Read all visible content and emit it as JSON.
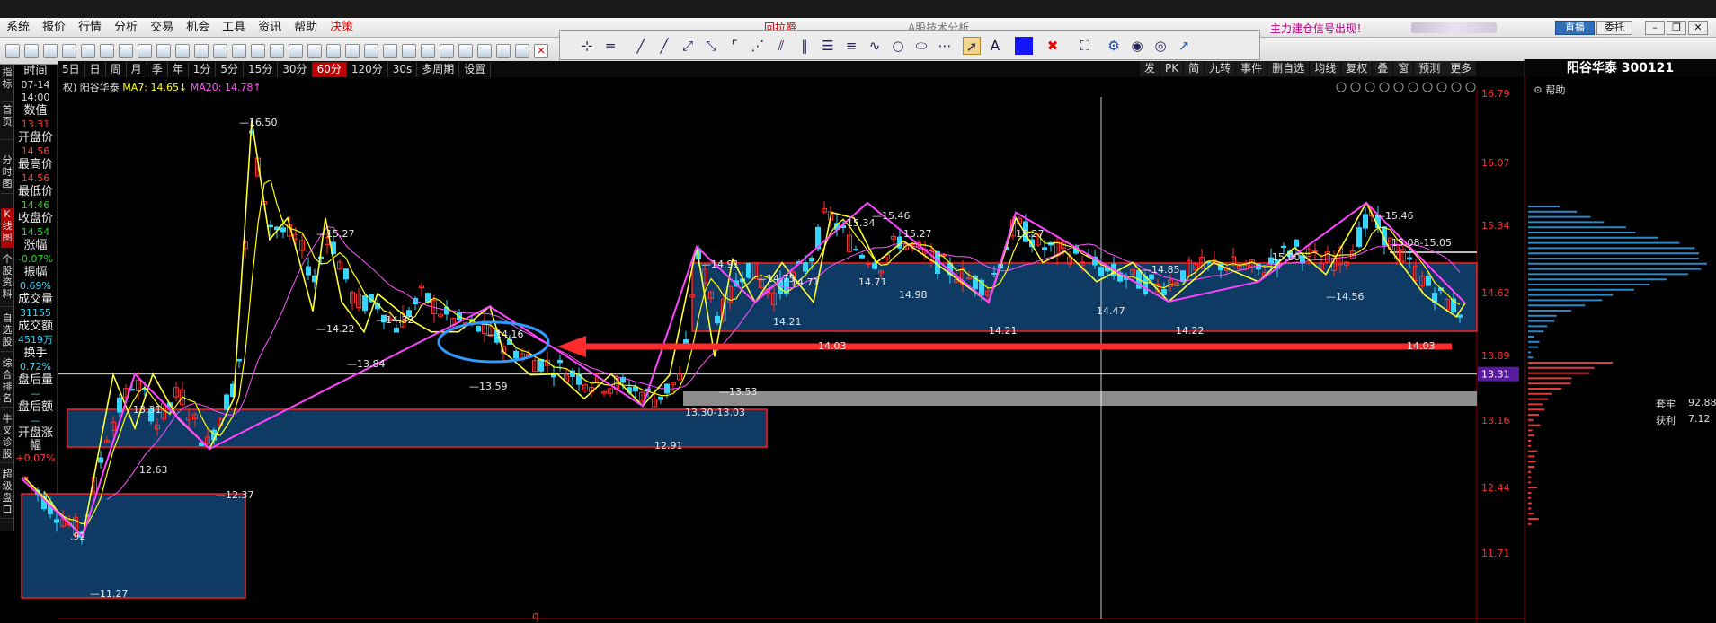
{
  "menu": {
    "items": [
      "系统",
      "报价",
      "行情",
      "分析",
      "交易",
      "机会",
      "工具",
      "资讯",
      "帮助"
    ],
    "highlight_item": "决策",
    "banner_partial": "回拉爵",
    "banner_partial2": "A股技术分析",
    "signal_text": "主力建仓信号出现！",
    "live_button": "直播",
    "order_button": "委托"
  },
  "periods": {
    "items": [
      "5日",
      "日",
      "周",
      "月",
      "季",
      "年",
      "1分",
      "5分",
      "15分",
      "30分",
      "60分",
      "120分",
      "30s",
      "多周期",
      "设置"
    ],
    "active": "60分"
  },
  "right_tools": [
    "发",
    "PK",
    "简",
    "九转",
    "事件",
    "删自选",
    "均线",
    "复权",
    "叠",
    "窗",
    "预测",
    "更多"
  ],
  "left_tabs": [
    "指标",
    "首页",
    "分时图",
    "K线图",
    "个股资料",
    "自选股",
    "综合排名",
    "牛叉诊股",
    "超级盘口"
  ],
  "info_panel": {
    "time_label": "时间",
    "date": "07-14",
    "time": "14:00",
    "value_label": "数值",
    "value": "13.31",
    "open_label": "开盘价",
    "open": "14.56",
    "high_label": "最高价",
    "high": "14.56",
    "low_label": "最低价",
    "low": "14.46",
    "close_label": "收盘价",
    "close": "14.54",
    "change_label": "涨幅",
    "change": "-0.07%",
    "amplitude_label": "振幅",
    "amplitude": "0.69%",
    "volume_label": "成交量",
    "volume": "31155",
    "amount_label": "成交额",
    "amount": "4519万",
    "turnover_label": "换手",
    "turnover": "0.72%",
    "after_volume_label": "盘后量",
    "after_volume": "—",
    "after_amount_label": "盘后额",
    "after_amount": "—",
    "open_change_label": "开盘涨幅",
    "open_change": "+0.07%"
  },
  "legend": {
    "prefix": "权)",
    "stock_name": "阳谷华泰",
    "ma7": "MA7: 14.65",
    "ma7_arrow": "↓",
    "ma20": "MA20: 14.78",
    "ma20_arrow": "↑"
  },
  "right_panel": {
    "title": "阳谷华泰 300121",
    "help": "帮助",
    "trapped_label": "套牢",
    "trapped_value": "92.88",
    "profit_label": "获利",
    "profit_value": "7.12"
  },
  "chart_data": {
    "type": "candlestick",
    "y_axis_ticks": [
      "16.79",
      "16.07",
      "15.34",
      "14.62",
      "13.89",
      "13.16",
      "12.44",
      "11.71"
    ],
    "crosshair_value": "13.31",
    "price_annotations": [
      "16.50",
      "15.27",
      "14.22",
      "13.84",
      "14.32",
      "14.16",
      "13.59",
      "13.31",
      "12.63",
      "12.37",
      "11.27",
      "13.92",
      "14.91",
      "14.75",
      "14.71",
      "14.21",
      "15.46",
      "15.34",
      "15.27",
      "14.71",
      "14.98",
      "14.21",
      "15.27",
      "14.85",
      "14.47",
      "14.22",
      "15.00",
      "14.56",
      "15.46",
      "15.08-15.05",
      "14.03",
      "13.53",
      "13.30-13.03",
      "12.91",
      "14.03"
    ],
    "bottom_marker": "q",
    "colors": {
      "up": "#ff3030",
      "down": "#33d6ff",
      "ma_short": "#ffff00",
      "ma_long": "#ff55ff",
      "zigzag": "#ff44ff",
      "box_fill": "#0e3a63",
      "box_border": "#ff2020",
      "gray_band": "#8c8c8c",
      "arrow": "#ff2a2a",
      "ellipse": "#2f9bff"
    }
  }
}
